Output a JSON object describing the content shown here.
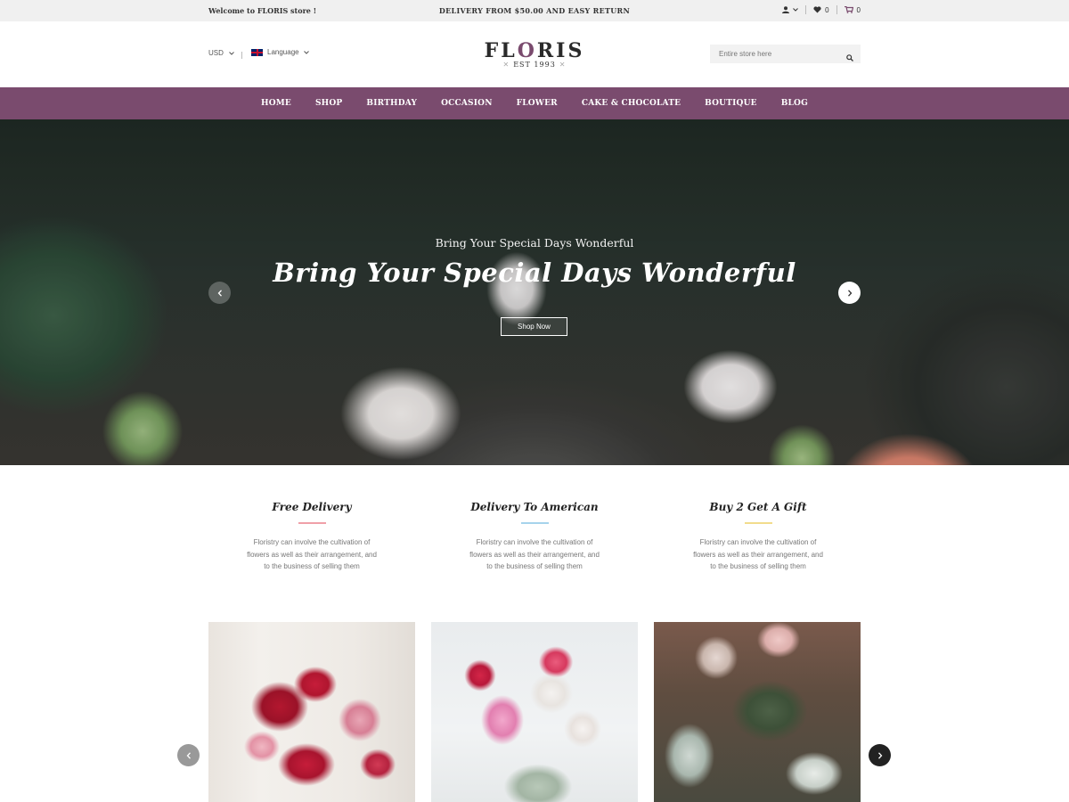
{
  "topbar": {
    "welcome": "Welcome to FLORIS store !",
    "promo": "DELIVERY FROM $50.00 AND EASY RETURN",
    "wishlist_count": "0",
    "cart_count": "0"
  },
  "header": {
    "currency": "USD",
    "language": "Language",
    "logo_name_start": "FL",
    "logo_name_o": "O",
    "logo_name_end": "RIS",
    "logo_est": "EST 1993",
    "search_placeholder": "Entire store here"
  },
  "nav": {
    "items": [
      "HOME",
      "SHOP",
      "BIRTHDAY",
      "OCCASION",
      "FLOWER",
      "CAKE & CHOCOLATE",
      "BOUTIQUE",
      "BLOG"
    ]
  },
  "hero": {
    "subtitle": "Bring Your Special Days Wonderful",
    "title": "Bring Your Special Days Wonderful",
    "button": "Shop Now"
  },
  "features": [
    {
      "title": "Free Delivery",
      "line_color": "#f0a0a8",
      "lines": [
        "Floristry can involve the cultivation of",
        "flowers as well as their arrangement, and",
        "to the business of selling them"
      ]
    },
    {
      "title": "Delivery To American",
      "line_color": "#a6d3ec",
      "lines": [
        "Floristry can involve the cultivation of",
        "flowers as well as their arrangement, and",
        "to the business of selling them"
      ]
    },
    {
      "title": "Buy 2 Get A Gift",
      "line_color": "#f2dc8c",
      "lines": [
        "Floristry can involve the cultivation of",
        "flowers as well as their arrangement, and",
        "to the business of selling them"
      ]
    }
  ],
  "colors": {
    "brand": "#7a4b6e"
  }
}
